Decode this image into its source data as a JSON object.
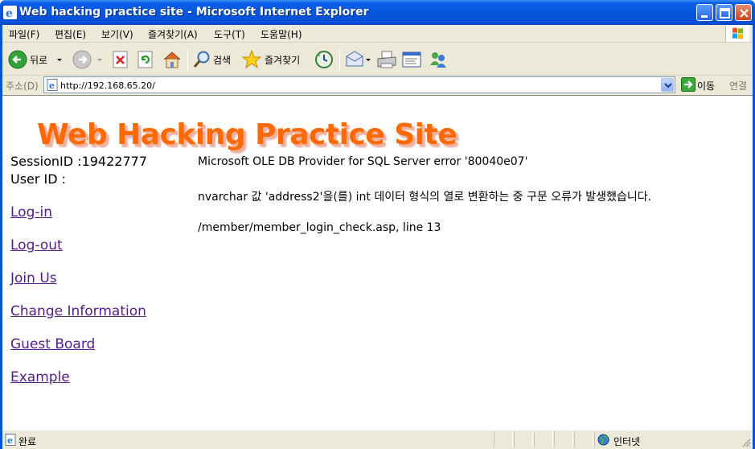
{
  "window": {
    "title": "Web hacking practice site - Microsoft Internet Explorer"
  },
  "menu": [
    {
      "label": "파일(F)"
    },
    {
      "label": "편집(E)"
    },
    {
      "label": "보기(V)"
    },
    {
      "label": "즐겨찾기(A)"
    },
    {
      "label": "도구(T)"
    },
    {
      "label": "도움말(H)"
    }
  ],
  "toolbar": {
    "back_label": "뒤로",
    "search_label": "검색",
    "favorites_label": "즐겨찾기"
  },
  "address": {
    "label": "주소(D)",
    "url": "http://192.168.65.20/",
    "go_label": "이동",
    "links_label": "연결"
  },
  "page": {
    "logo_text": "Web Hacking Practice Site",
    "session_line": "SessionID :19422777",
    "userid_line": "User ID :",
    "nav": [
      {
        "label": "Log-in"
      },
      {
        "label": "Log-out"
      },
      {
        "label": "Join Us"
      },
      {
        "label": "Change Information"
      },
      {
        "label": "Guest Board"
      },
      {
        "label": "Example"
      }
    ],
    "error": {
      "line1": "Microsoft OLE DB Provider for SQL Server error '80040e07'",
      "line2": "nvarchar 값 'address2'을(를) int 데이터 형식의 열로 변환하는 중 구문 오류가 발생했습니다.",
      "line3": "/member/member_login_check.asp, line 13"
    }
  },
  "status": {
    "text": "완료",
    "zone": "인터넷"
  },
  "colors": {
    "title_bar": "#0550d6",
    "logo": "#ff6a00",
    "visited_link": "#551a8b",
    "chrome": "#ece9d8"
  }
}
